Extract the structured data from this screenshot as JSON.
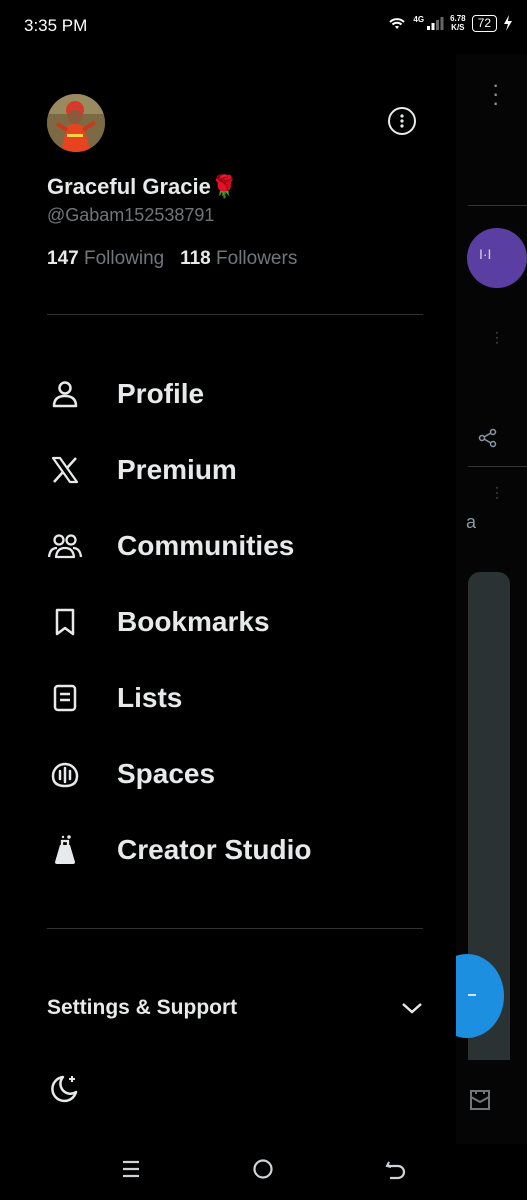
{
  "status": {
    "time": "3:35 PM",
    "network": "4G",
    "speed_value": "6.78",
    "speed_unit": "K/S",
    "battery": "72"
  },
  "profile": {
    "display_name": "Graceful Gracie",
    "name_emoji": "🌹",
    "handle": "@Gabam152538791",
    "following_count": "147",
    "following_label": "Following",
    "followers_count": "118",
    "followers_label": "Followers"
  },
  "menu": [
    {
      "label": "Profile",
      "icon": "person-icon"
    },
    {
      "label": "Premium",
      "icon": "x-logo-icon"
    },
    {
      "label": "Communities",
      "icon": "communities-icon"
    },
    {
      "label": "Bookmarks",
      "icon": "bookmark-icon"
    },
    {
      "label": "Lists",
      "icon": "list-icon"
    },
    {
      "label": "Spaces",
      "icon": "spaces-icon"
    },
    {
      "label": "Creator Studio",
      "icon": "flask-icon"
    }
  ],
  "settings": {
    "label": "Settings & Support"
  },
  "background": {
    "partial_letter": "a"
  },
  "colors": {
    "background": "#000000",
    "text": "#e7e9ea",
    "secondary": "#71767b",
    "divider": "#2f3336",
    "accent_purple": "#5b3ea1",
    "fab_blue": "#1d8fe0"
  }
}
